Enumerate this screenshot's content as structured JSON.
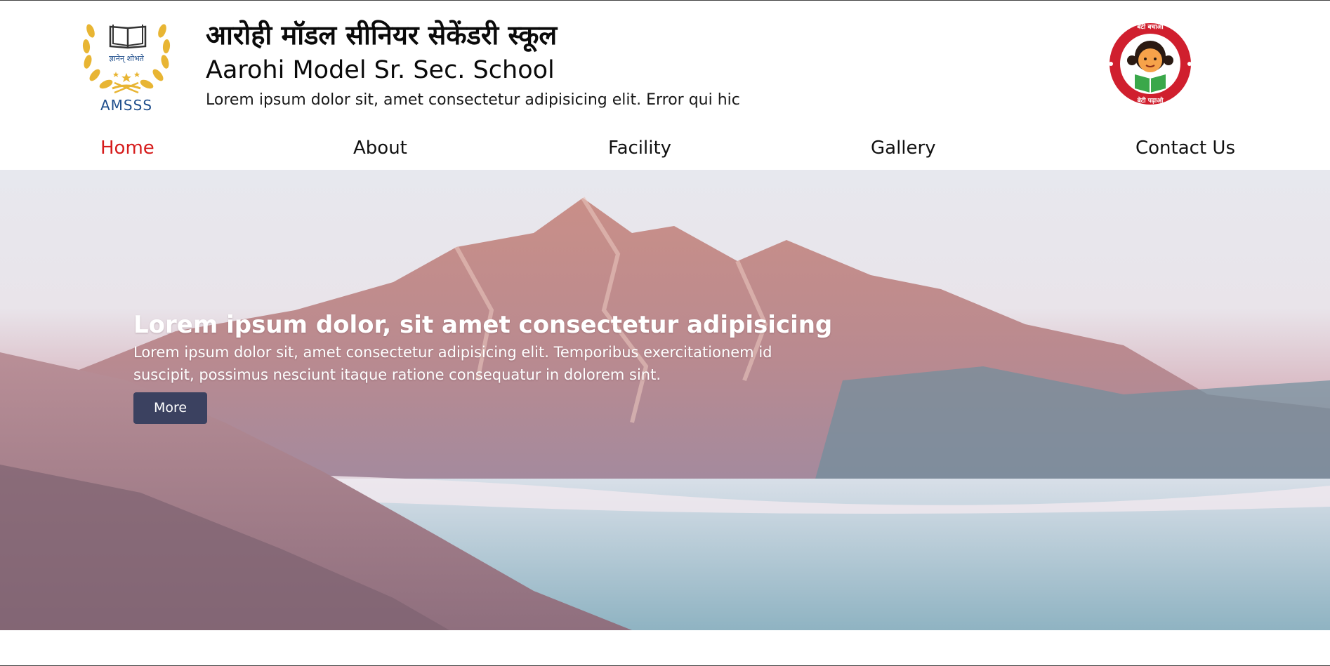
{
  "header": {
    "logo_text": "AMSSS",
    "logo_motto": "ज्ञानेन् शोभते",
    "title_hindi": "आरोही मॉडल सीनियर सेकेंडरी स्कूल",
    "title_english": "Aarohi Model Sr. Sec. School",
    "tagline": "Lorem ipsum dolor sit, amet consectetur adipisicing elit. Error qui hic",
    "badge_top_text": "बेटी बचाओ",
    "badge_bottom_text": "बेटी पढ़ाओ"
  },
  "nav": {
    "items": [
      {
        "label": "Home",
        "active": true
      },
      {
        "label": "About",
        "active": false
      },
      {
        "label": "Facility",
        "active": false
      },
      {
        "label": "Gallery",
        "active": false
      },
      {
        "label": "Contact Us",
        "active": false
      }
    ]
  },
  "hero": {
    "title": "Lorem ipsum dolor, sit amet consectetur adipisicing",
    "text": "Lorem ipsum dolor sit, amet consectetur adipisicing elit. Temporibus exercitationem id suscipit, possimus nesciunt itaque ratione consequatur in dolorem sint.",
    "button_label": "More"
  },
  "colors": {
    "accent_active": "#d61c1c",
    "button_bg": "#3b4160",
    "logo_gold": "#e8b533",
    "logo_blue": "#1f4e8c",
    "badge_red": "#d01f2e"
  },
  "icons": [
    "open-book-icon",
    "laurel-wreath-icon",
    "girl-child-icon"
  ]
}
